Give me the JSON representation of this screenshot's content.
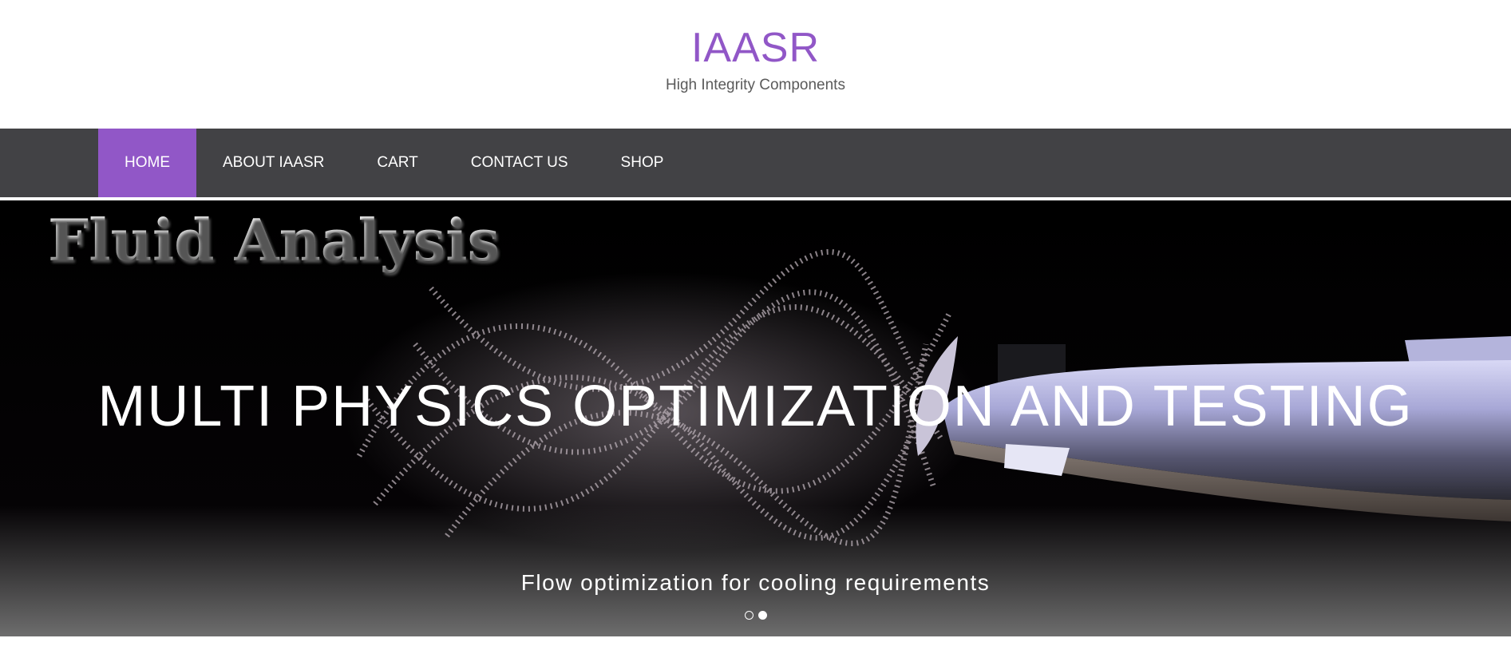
{
  "site": {
    "title": "IAASR",
    "tagline": "High Integrity Components",
    "accent_color": "#9157c7",
    "nav_bg_color": "#424245"
  },
  "nav": {
    "items": [
      {
        "label": "HOME",
        "active": true
      },
      {
        "label": "ABOUT IAASR",
        "active": false
      },
      {
        "label": "CART",
        "active": false
      },
      {
        "label": "CONTACT US",
        "active": false
      },
      {
        "label": "SHOP",
        "active": false
      }
    ]
  },
  "slider": {
    "image_text": "Fluid Analysis",
    "heading": "MULTI PHYSICS OPTIMIZATION AND TESTING",
    "caption": "Flow optimization for cooling requirements",
    "slide_count": 2,
    "active_slide": 2
  }
}
